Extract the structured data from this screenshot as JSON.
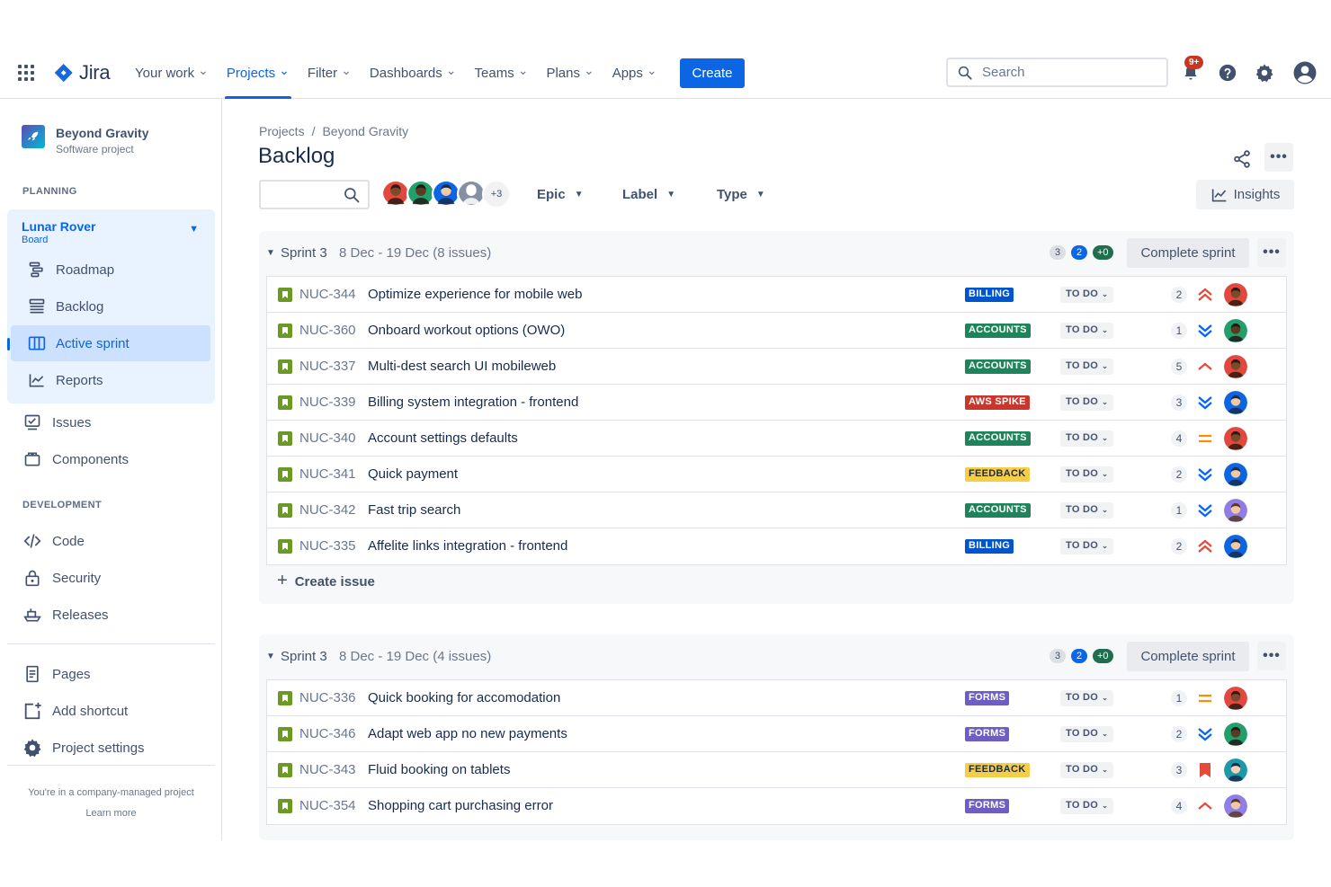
{
  "topnav": {
    "logo_text": "Jira",
    "items": [
      {
        "label": "Your work",
        "active": false
      },
      {
        "label": "Projects",
        "active": true
      },
      {
        "label": "Filter",
        "active": false
      },
      {
        "label": "Dashboards",
        "active": false
      },
      {
        "label": "Teams",
        "active": false
      },
      {
        "label": "Plans",
        "active": false
      },
      {
        "label": "Apps",
        "active": false
      }
    ],
    "create_label": "Create",
    "search_placeholder": "Search",
    "notification_badge": "9+"
  },
  "sidebar": {
    "project_name": "Beyond Gravity",
    "project_type": "Software project",
    "planning_heading": "PLANNING",
    "board_name": "Lunar Rover",
    "board_sub": "Board",
    "board_items": [
      {
        "label": "Roadmap",
        "icon": "roadmap-icon"
      },
      {
        "label": "Backlog",
        "icon": "backlog-icon"
      },
      {
        "label": "Active sprint",
        "icon": "board-icon",
        "selected": true
      },
      {
        "label": "Reports",
        "icon": "reports-icon"
      }
    ],
    "issues_label": "Issues",
    "components_label": "Components",
    "development_heading": "DEVELOPMENT",
    "dev_items": [
      {
        "label": "Code",
        "icon": "code-icon"
      },
      {
        "label": "Security",
        "icon": "lock-icon"
      },
      {
        "label": "Releases",
        "icon": "ship-icon"
      }
    ],
    "bottom_items": [
      {
        "label": "Pages",
        "icon": "page-icon"
      },
      {
        "label": "Add shortcut",
        "icon": "add-shortcut-icon"
      },
      {
        "label": "Project settings",
        "icon": "gear-icon"
      }
    ],
    "footer_text": "You're in a company-managed project",
    "footer_link": "Learn more"
  },
  "main": {
    "breadcrumb": [
      "Projects",
      "Beyond Gravity"
    ],
    "title": "Backlog",
    "avatar_more": "+3",
    "filters": [
      "Epic",
      "Label",
      "Type"
    ],
    "insights_label": "Insights",
    "create_issue_label": "Create issue"
  },
  "colors": {
    "primary": "#0c66e4",
    "billing": "#0055cc",
    "accounts": "#1f845a",
    "aws_spike": "#c9372c",
    "feedback": "#f5cd47",
    "forms": "#6e5dc6"
  },
  "sprints": [
    {
      "name": "Sprint 3",
      "dates": "8 Dec - 19 Dec (8 issues)",
      "counts": [
        "3",
        "2",
        "+0"
      ],
      "complete_label": "Complete sprint",
      "issues": [
        {
          "key": "NUC-344",
          "summary": "Optimize experience for mobile web",
          "label": "BILLING",
          "label_color": "billing",
          "status": "TO DO",
          "estimate": "2",
          "priority": "highest",
          "assignee": "a1"
        },
        {
          "key": "NUC-360",
          "summary": "Onboard workout options (OWO)",
          "label": "ACCOUNTS",
          "label_color": "accounts",
          "status": "TO DO",
          "estimate": "1",
          "priority": "lowest",
          "assignee": "a2"
        },
        {
          "key": "NUC-337",
          "summary": "Multi-dest search UI mobileweb",
          "label": "ACCOUNTS",
          "label_color": "accounts",
          "status": "TO DO",
          "estimate": "5",
          "priority": "high",
          "assignee": "a1"
        },
        {
          "key": "NUC-339",
          "summary": "Billing system integration - frontend",
          "label": "AWS SPIKE",
          "label_color": "aws_spike",
          "status": "TO DO",
          "estimate": "3",
          "priority": "lowest",
          "assignee": "a3"
        },
        {
          "key": "NUC-340",
          "summary": "Account settings defaults",
          "label": "ACCOUNTS",
          "label_color": "accounts",
          "status": "TO DO",
          "estimate": "4",
          "priority": "medium",
          "assignee": "a1"
        },
        {
          "key": "NUC-341",
          "summary": "Quick payment",
          "label": "FEEDBACK",
          "label_color": "feedback",
          "status": "TO DO",
          "estimate": "2",
          "priority": "lowest",
          "assignee": "a3"
        },
        {
          "key": "NUC-342",
          "summary": "Fast trip search",
          "label": "ACCOUNTS",
          "label_color": "accounts",
          "status": "TO DO",
          "estimate": "1",
          "priority": "lowest",
          "assignee": "a4"
        },
        {
          "key": "NUC-335",
          "summary": "Affelite links integration - frontend",
          "label": "BILLING",
          "label_color": "billing",
          "status": "TO DO",
          "estimate": "2",
          "priority": "highest",
          "assignee": "a3"
        }
      ]
    },
    {
      "name": "Sprint 3",
      "dates": "8 Dec - 19 Dec (4 issues)",
      "counts": [
        "3",
        "2",
        "+0"
      ],
      "complete_label": "Complete sprint",
      "issues": [
        {
          "key": "NUC-336",
          "summary": "Quick booking for accomodation",
          "label": "FORMS",
          "label_color": "forms",
          "status": "TO DO",
          "estimate": "1",
          "priority": "medium",
          "assignee": "a1"
        },
        {
          "key": "NUC-346",
          "summary": "Adapt web app no new payments",
          "label": "FORMS",
          "label_color": "forms",
          "status": "TO DO",
          "estimate": "2",
          "priority": "lowest",
          "assignee": "a2"
        },
        {
          "key": "NUC-343",
          "summary": "Fluid booking on tablets",
          "label": "FEEDBACK",
          "label_color": "feedback",
          "status": "TO DO",
          "estimate": "3",
          "priority": "blocker",
          "assignee": "a5"
        },
        {
          "key": "NUC-354",
          "summary": "Shopping cart purchasing error",
          "label": "FORMS",
          "label_color": "forms",
          "status": "TO DO",
          "estimate": "4",
          "priority": "high",
          "assignee": "a4"
        }
      ]
    }
  ]
}
